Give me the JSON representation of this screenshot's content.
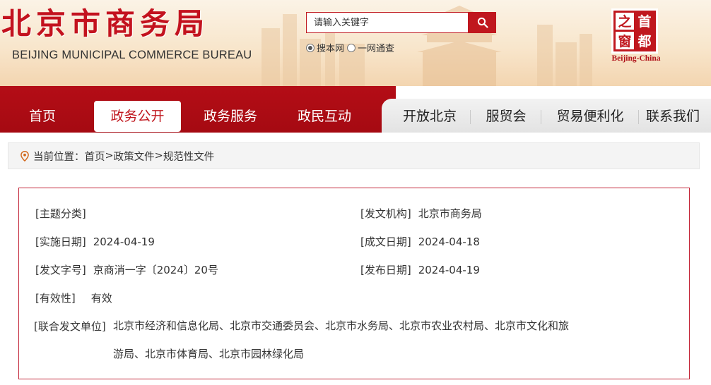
{
  "header": {
    "title": "北京市商务局",
    "subtitle": "BEIJING MUNICIPAL COMMERCE BUREAU",
    "search": {
      "placeholder": "请输入关键字",
      "scope_options": [
        "搜本网",
        "一网通查"
      ],
      "selected_scope": "搜本网"
    },
    "logo": {
      "characters": [
        "之",
        "首",
        "窗",
        "都"
      ],
      "caption": "Beijing-China"
    }
  },
  "nav": {
    "items": [
      {
        "label": "首页"
      },
      {
        "label": "政务公开",
        "active": true
      },
      {
        "label": "政务服务"
      },
      {
        "label": "政民互动"
      },
      {
        "label": "开放北京"
      },
      {
        "label": "服贸会"
      },
      {
        "label": "贸易便利化"
      },
      {
        "label": "联系我们"
      }
    ]
  },
  "breadcrumb": {
    "prefix": "当前位置：",
    "items": [
      "首页",
      "政策文件",
      "规范性文件"
    ],
    "separator": ">"
  },
  "document_meta": {
    "topic": {
      "label": "[主题分类]",
      "value": ""
    },
    "issuer": {
      "label": "[发文机构]",
      "value": "北京市商务局"
    },
    "effective_date": {
      "label": "[实施日期]",
      "value": "2024-04-19"
    },
    "written_date": {
      "label": "[成文日期]",
      "value": "2024-04-18"
    },
    "doc_number": {
      "label": "[发文字号]",
      "value": "京商消一字〔2024〕20号"
    },
    "publish_date": {
      "label": "[发布日期]",
      "value": "2024-04-19"
    },
    "validity": {
      "label": "[有效性]",
      "value": "有效"
    },
    "joint_units": {
      "label": "[联合发文单位]",
      "line1": "北京市经济和信息化局、北京市交通委员会、北京市水务局、北京市农业农村局、北京市文化和旅",
      "line2": "游局、北京市体育局、北京市园林绿化局"
    }
  },
  "colors": {
    "brand_red": "#c0171e",
    "nav_red": "#b40d16",
    "box_border": "#c4283a"
  },
  "icons": {
    "search_button": "search-icon",
    "breadcrumb": "location-pin-icon"
  }
}
